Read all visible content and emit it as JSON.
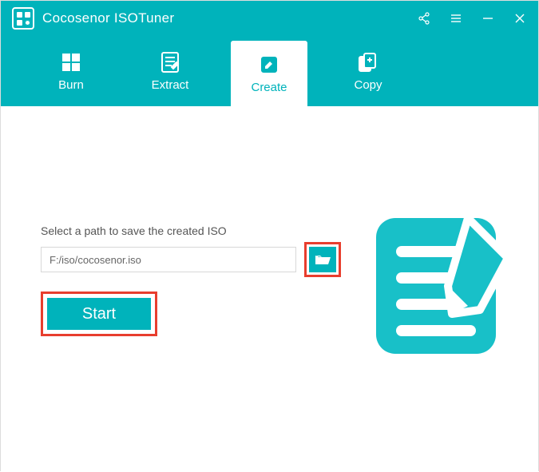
{
  "title_bar": {
    "app_name": "Cocosenor ISOTuner"
  },
  "tabs": {
    "burn": "Burn",
    "extract": "Extract",
    "create": "Create",
    "copy": "Copy"
  },
  "create_panel": {
    "label": "Select a path to save the created ISO",
    "path_value": "F:/iso/cocosenor.iso",
    "start": "Start"
  },
  "colors": {
    "primary": "#00b3bb",
    "highlight_border": "#e83e2e"
  }
}
